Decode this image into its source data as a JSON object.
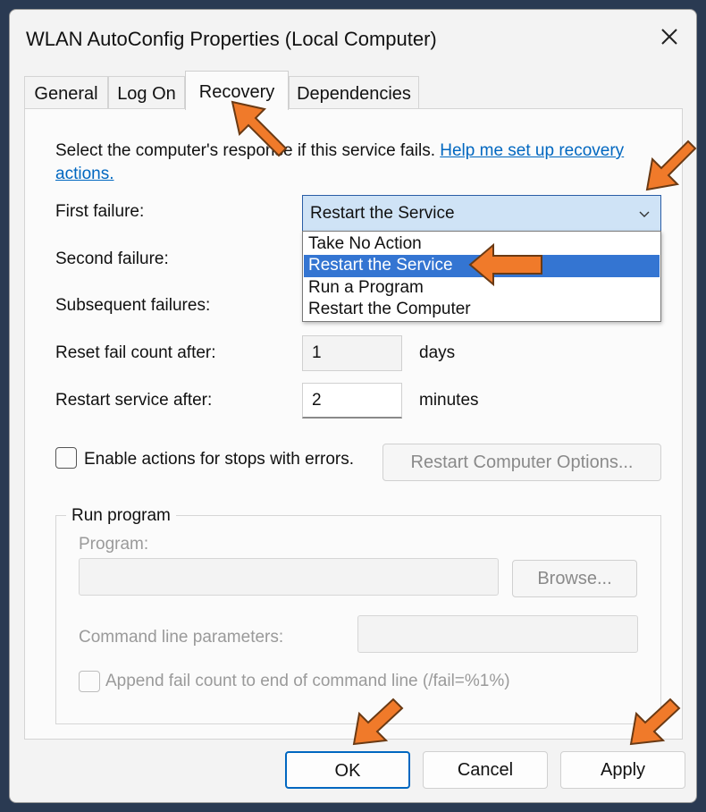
{
  "window": {
    "title": "WLAN AutoConfig Properties (Local Computer)",
    "close_icon": "close-icon"
  },
  "tabs": [
    {
      "label": "General",
      "active": false
    },
    {
      "label": "Log On",
      "active": false
    },
    {
      "label": "Recovery",
      "active": true
    },
    {
      "label": "Dependencies",
      "active": false
    }
  ],
  "recovery": {
    "intro_text": "Select the computer's response if this service fails.",
    "help_link": "Help me set up recovery actions.",
    "first_failure_label": "First failure:",
    "first_failure_value": "Restart the Service",
    "second_failure_label": "Second failure:",
    "subsequent_failures_label": "Subsequent failures:",
    "dropdown_options": [
      "Take No Action",
      "Restart the Service",
      "Run a Program",
      "Restart the Computer"
    ],
    "dropdown_selected_index": 1,
    "reset_label": "Reset fail count after:",
    "reset_value": "1",
    "reset_unit": "days",
    "restart_label": "Restart service after:",
    "restart_value": "2",
    "restart_unit": "minutes",
    "enable_actions_label": "Enable actions for stops with errors.",
    "restart_computer_options_button": "Restart Computer Options..."
  },
  "run_program": {
    "group_title": "Run program",
    "program_label": "Program:",
    "program_value": "",
    "browse_button": "Browse...",
    "cmd_label": "Command line parameters:",
    "cmd_value": "",
    "append_label": "Append fail count to end of command line (/fail=%1%)"
  },
  "buttons": {
    "ok": "OK",
    "cancel": "Cancel",
    "apply": "Apply"
  },
  "colors": {
    "accent": "#0067c0",
    "selection": "#3475d2",
    "annotation_arrow": "#f07a2a"
  }
}
